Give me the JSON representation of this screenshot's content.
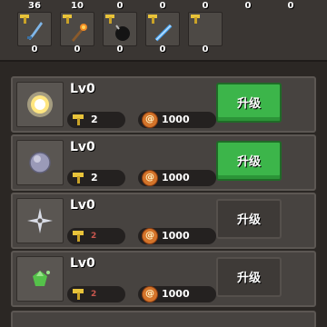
{
  "top_slots": [
    {
      "count": "36",
      "level": "0",
      "icon": "blue-dagger-icon"
    },
    {
      "count": "10",
      "level": "0",
      "icon": "torch-icon"
    },
    {
      "count": "0",
      "level": "0",
      "icon": "dark-bomb-icon"
    },
    {
      "count": "0",
      "level": "0",
      "icon": "ice-sword-icon"
    },
    {
      "count": "0",
      "level": "0",
      "icon": "boomerang-icon"
    },
    {
      "count": "0",
      "level": "",
      "icon": ""
    },
    {
      "count": "0",
      "level": "",
      "icon": ""
    }
  ],
  "weapons": [
    {
      "level": "Lv0",
      "stat": "2",
      "cost": "1000",
      "upgrade_label": "升级",
      "enabled": true,
      "icon": "glowing-orb-icon"
    },
    {
      "level": "Lv0",
      "stat": "2",
      "cost": "1000",
      "upgrade_label": "升级",
      "enabled": true,
      "icon": "stone-ball-icon"
    },
    {
      "level": "Lv0",
      "stat": "2",
      "cost": "1000",
      "upgrade_label": "升级",
      "enabled": false,
      "icon": "shuriken-icon"
    },
    {
      "level": "Lv0",
      "stat": "2",
      "cost": "1000",
      "upgrade_label": "升级",
      "enabled": false,
      "icon": "green-gem-icon"
    }
  ],
  "colors": {
    "upgrade_enabled": "#3cb54a",
    "upgrade_disabled": "#3e3a37",
    "coin": "#d4742a"
  }
}
